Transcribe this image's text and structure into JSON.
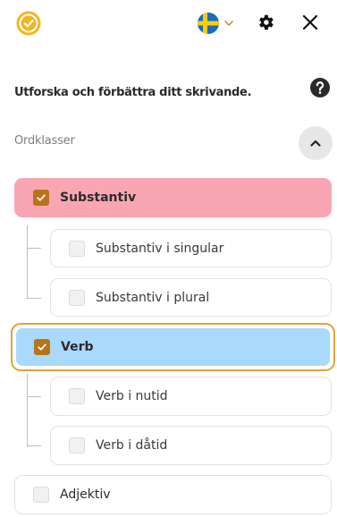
{
  "header": {
    "logo_icon": "check-badge-icon",
    "language_flag": "sweden-flag-icon",
    "settings_icon": "gear-icon",
    "close_icon": "close-icon"
  },
  "intro": {
    "tagline": "Utforska och förbättra ditt skrivande.",
    "help_icon": "question-icon"
  },
  "section": {
    "title": "Ordklasser",
    "collapse_icon": "chevron-up-icon"
  },
  "word_classes": [
    {
      "label": "Substantiv",
      "checked": true,
      "color": "#f9a6b4"
    },
    {
      "label": "Substantiv i singular",
      "checked": false
    },
    {
      "label": "Substantiv i plural",
      "checked": false
    },
    {
      "label": "Verb",
      "checked": true,
      "color": "#a9dafc",
      "focused": true
    },
    {
      "label": "Verb i nutid",
      "checked": false
    },
    {
      "label": "Verb i dåtid",
      "checked": false
    },
    {
      "label": "Adjektiv",
      "checked": false
    }
  ],
  "colors": {
    "accent": "#e1a23a",
    "checkbox_checked": "#b8741a",
    "logo": "#f2b523"
  }
}
